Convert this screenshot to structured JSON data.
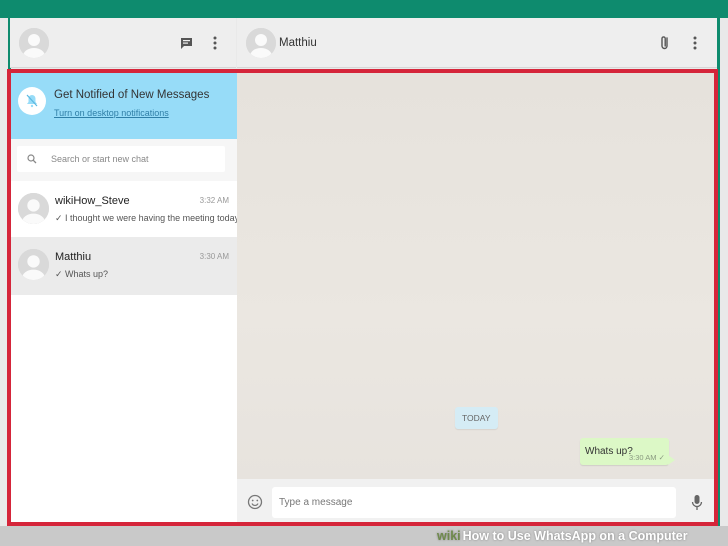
{
  "header": {
    "contact_name": "Matthiu"
  },
  "notification": {
    "title": "Get Notified of New Messages",
    "link": "Turn on desktop notifications"
  },
  "search": {
    "placeholder": "Search or start new chat"
  },
  "chats": [
    {
      "name": "wikiHow_Steve",
      "time": "3:32 AM",
      "last_message": "✓ I thought we were having the meeting today!",
      "selected": false
    },
    {
      "name": "Matthiu",
      "time": "3:30 AM",
      "last_message": "✓ Whats up?",
      "selected": true
    }
  ],
  "conversation": {
    "date_chip": "TODAY",
    "messages": [
      {
        "text": "Whats up?",
        "time": "3:30 AM ✓",
        "outgoing": true
      }
    ]
  },
  "composer": {
    "placeholder": "Type a message"
  },
  "watermark": {
    "brand": "wiki",
    "text": "How to Use WhatsApp on a Computer"
  },
  "colors": {
    "frame_green": "#0e8b6e",
    "highlight_red": "#d5253a",
    "notify_blue": "#97dcf8",
    "bubble_green": "#dcf8c6"
  }
}
